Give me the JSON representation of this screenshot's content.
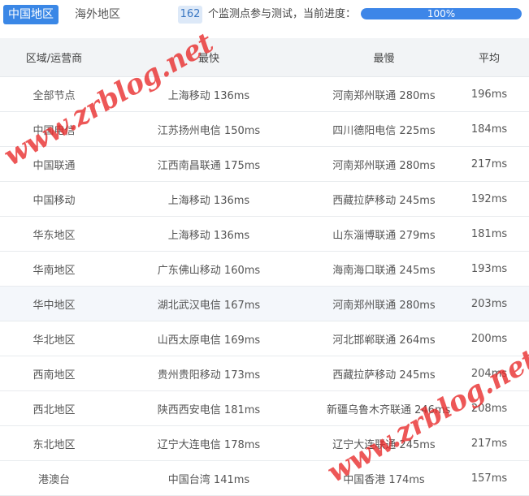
{
  "tabs": [
    {
      "label": "中国地区",
      "active": true
    },
    {
      "label": "海外地区",
      "active": false
    }
  ],
  "status": {
    "count": "162",
    "text": "个监测点参与测试，当前进度：",
    "progress_label": "100%",
    "progress_fraction": 1.0
  },
  "table": {
    "headers": [
      "区域/运营商",
      "最快",
      "最慢",
      "平均"
    ],
    "rows": [
      {
        "region": "全部节点",
        "fastest": "上海移动 136ms",
        "slowest": "河南郑州联通 280ms",
        "average": "196ms"
      },
      {
        "region": "中国电信",
        "fastest": "江苏扬州电信 150ms",
        "slowest": "四川德阳电信 225ms",
        "average": "184ms"
      },
      {
        "region": "中国联通",
        "fastest": "江西南昌联通 175ms",
        "slowest": "河南郑州联通 280ms",
        "average": "217ms"
      },
      {
        "region": "中国移动",
        "fastest": "上海移动 136ms",
        "slowest": "西藏拉萨移动 245ms",
        "average": "192ms"
      },
      {
        "region": "华东地区",
        "fastest": "上海移动 136ms",
        "slowest": "山东淄博联通 279ms",
        "average": "181ms"
      },
      {
        "region": "华南地区",
        "fastest": "广东佛山移动 160ms",
        "slowest": "海南海口联通 245ms",
        "average": "193ms"
      },
      {
        "region": "华中地区",
        "fastest": "湖北武汉电信 167ms",
        "slowest": "河南郑州联通 280ms",
        "average": "203ms"
      },
      {
        "region": "华北地区",
        "fastest": "山西太原电信 169ms",
        "slowest": "河北邯郸联通 264ms",
        "average": "200ms"
      },
      {
        "region": "西南地区",
        "fastest": "贵州贵阳移动 173ms",
        "slowest": "西藏拉萨移动 245ms",
        "average": "204ms"
      },
      {
        "region": "西北地区",
        "fastest": "陕西西安电信 181ms",
        "slowest": "新疆乌鲁木齐联通 246ms",
        "average": "208ms"
      },
      {
        "region": "东北地区",
        "fastest": "辽宁大连电信 178ms",
        "slowest": "辽宁大连联通 245ms",
        "average": "217ms"
      },
      {
        "region": "港澳台",
        "fastest": "中国台湾 141ms",
        "slowest": "中国香港 174ms",
        "average": "157ms"
      }
    ]
  },
  "watermark": "www.zrblog.net",
  "colors": {
    "accent": "#3a87e6",
    "watermark": "#e82828"
  }
}
